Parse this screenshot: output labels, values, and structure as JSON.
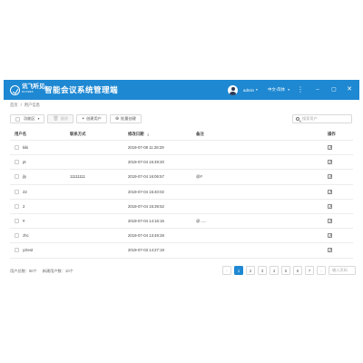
{
  "header": {
    "logo_text": "讯飞听见",
    "logo_sub": "IFLYREC",
    "title": "智能会议系统管理端",
    "username": "admin",
    "lang": "中文-简体",
    "icons": {
      "more": "⋮",
      "minimize": "–",
      "maximize": "▢",
      "close": "✕"
    }
  },
  "breadcrumb": {
    "home": "首页",
    "sep": "/",
    "current": "用户信息"
  },
  "toolbar": {
    "filter_label": "功能区",
    "delete_label": "删除",
    "create_label": "创建用户",
    "batch_label": "批量创建"
  },
  "search": {
    "placeholder": "搜索用户"
  },
  "table": {
    "columns": {
      "user": "用户名",
      "contact": "联系方式",
      "date": "修改日期",
      "note": "备注",
      "op": "操作"
    },
    "rows": [
      {
        "user": "kiki",
        "contact": "",
        "date": "2019-07-08 11:28:29",
        "note": ""
      },
      {
        "user": "pt",
        "contact": "",
        "date": "2019-07-04 16:49:20",
        "note": ""
      },
      {
        "user": "jly",
        "contact": "11111111",
        "date": "2019-07-04 16:06:57",
        "note": "@#"
      },
      {
        "user": "22",
        "contact": "",
        "date": "2019-07-04 15:40:02",
        "note": ""
      },
      {
        "user": "2",
        "contact": "",
        "date": "2019-07-04 15:39:52",
        "note": ""
      },
      {
        "user": "#",
        "contact": "",
        "date": "2019-07-04 14:16:16",
        "note": "@......"
      },
      {
        "user": "zhc",
        "contact": "",
        "date": "2019-07-04 13:49:28",
        "note": ""
      },
      {
        "user": "yztest",
        "contact": "",
        "date": "2019-07-03 14:27:19",
        "note": ""
      }
    ]
  },
  "footer": {
    "total_users": "用户总数：50个",
    "total_pages": "新建用户数：10个"
  },
  "pagination": {
    "prev": "‹",
    "next": "›",
    "pages": [
      "1",
      "2",
      "3",
      "4",
      "5",
      "6",
      "7"
    ],
    "active": "1",
    "jump_placeholder": "输入页码"
  },
  "colors": {
    "primary": "#1e88d2"
  }
}
